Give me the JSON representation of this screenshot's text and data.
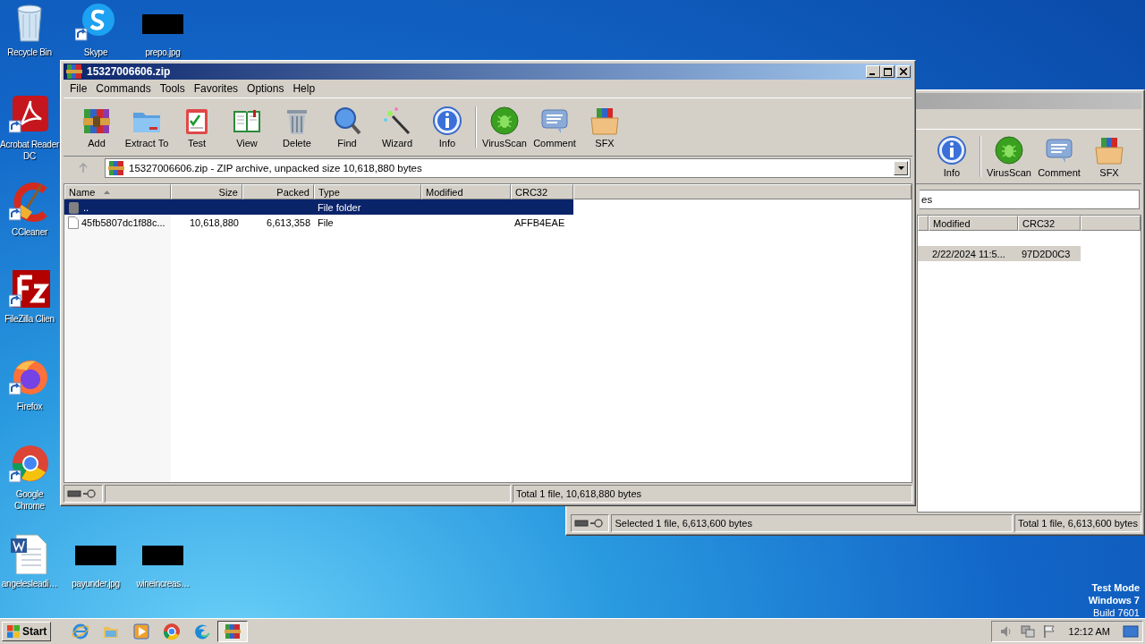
{
  "desktop_icons": [
    {
      "label": "Recycle Bin",
      "kind": "recycle"
    },
    {
      "label": "Skype",
      "kind": "skype"
    },
    {
      "label": "prepo.jpg",
      "kind": "thumb"
    },
    {
      "label": "Acrobat Reader DC",
      "kind": "acrobat"
    },
    {
      "label": "CCleaner",
      "kind": "ccleaner"
    },
    {
      "label": "FileZilla Clien",
      "kind": "filezilla"
    },
    {
      "label": "Firefox",
      "kind": "firefox"
    },
    {
      "label": "Google Chrome",
      "kind": "chrome"
    },
    {
      "label": "angelesleadi…",
      "kind": "word"
    },
    {
      "label": "payunder.jpg",
      "kind": "thumb"
    },
    {
      "label": "wineincreas…",
      "kind": "thumb"
    }
  ],
  "os_notice": {
    "mode": "Test Mode",
    "os": "Windows 7",
    "build": "Build 7601"
  },
  "back_window": {
    "toolbar": [
      {
        "label": "Info",
        "kind": "info"
      },
      {
        "label": "VirusScan",
        "kind": "virusscan"
      },
      {
        "label": "Comment",
        "kind": "comment"
      },
      {
        "label": "SFX",
        "kind": "sfx"
      }
    ],
    "address": "es",
    "columns": [
      "Modified",
      "CRC32"
    ],
    "rows": [
      {
        "selected": true,
        "modified": "2/22/2024 11:5...",
        "crc32": "97D2D0C3"
      }
    ],
    "status_selected": "Selected 1 file, 6,613,600 bytes",
    "status_total": "Total 1 file, 6,613,600 bytes"
  },
  "window": {
    "title": "15327006606.zip",
    "menu": [
      "File",
      "Commands",
      "Tools",
      "Favorites",
      "Options",
      "Help"
    ],
    "toolbar": [
      {
        "label": "Add",
        "kind": "add"
      },
      {
        "label": "Extract To",
        "kind": "extract"
      },
      {
        "label": "Test",
        "kind": "test"
      },
      {
        "label": "View",
        "kind": "view"
      },
      {
        "label": "Delete",
        "kind": "delete"
      },
      {
        "label": "Find",
        "kind": "find"
      },
      {
        "label": "Wizard",
        "kind": "wizard"
      },
      {
        "label": "Info",
        "kind": "info"
      },
      {
        "label": "VirusScan",
        "kind": "virusscan"
      },
      {
        "label": "Comment",
        "kind": "comment"
      },
      {
        "label": "SFX",
        "kind": "sfx"
      }
    ],
    "address": "15327006606.zip - ZIP archive, unpacked size 10,618,880 bytes",
    "columns": [
      {
        "label": "Name",
        "sorted": true
      },
      {
        "label": "Size",
        "sorted": false
      },
      {
        "label": "Packed",
        "sorted": false
      },
      {
        "label": "Type",
        "sorted": false
      },
      {
        "label": "Modified",
        "sorted": false
      },
      {
        "label": "CRC32",
        "sorted": false
      }
    ],
    "rows": [
      {
        "kind": "parent",
        "selected": true,
        "name": "..",
        "type": "File folder"
      },
      {
        "kind": "file",
        "selected": false,
        "name": "45fb5807dc1f88c...",
        "size": "10,618,880",
        "packed": "6,613,358",
        "type": "File",
        "crc32": "AFFB4EAE"
      }
    ],
    "status": "Total 1 file, 10,618,880 bytes"
  },
  "taskbar": {
    "start": "Start",
    "apps": [
      {
        "kind": "ie",
        "selected": false
      },
      {
        "kind": "explorer",
        "selected": false
      },
      {
        "kind": "media",
        "selected": false
      },
      {
        "kind": "chrome",
        "selected": false
      },
      {
        "kind": "edge",
        "selected": false
      },
      {
        "kind": "winrar",
        "selected": true
      }
    ],
    "clock": "12:12 AM"
  }
}
